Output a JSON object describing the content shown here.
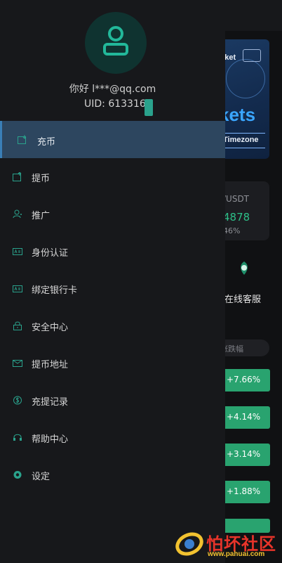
{
  "drawer": {
    "greeting": "你好 l***@qq.com",
    "uid": "UID: 613316"
  },
  "menu": [
    {
      "label": "充币",
      "icon": "deposit-icon",
      "active": true
    },
    {
      "label": "提币",
      "icon": "withdraw-icon"
    },
    {
      "label": "推广",
      "icon": "promote-icon"
    },
    {
      "label": "身份认证",
      "icon": "id-card-icon"
    },
    {
      "label": "绑定银行卡",
      "icon": "bank-card-icon"
    },
    {
      "label": "安全中心",
      "icon": "lock-icon"
    },
    {
      "label": "提币地址",
      "icon": "address-icon"
    },
    {
      "label": "充提记录",
      "icon": "coin-record-icon"
    },
    {
      "label": "帮助中心",
      "icon": "headset-icon"
    },
    {
      "label": "设定",
      "icon": "settings-icon"
    }
  ],
  "background": {
    "banner_title": "rket",
    "banner_big": "kets",
    "banner_sub": "Timezone",
    "ticker_pair": "/USDT",
    "ticker_price": "4878",
    "ticker_change": "46%",
    "service_label": "在线客服",
    "filter_label": "涨跌幅",
    "changes": [
      "+7.66%",
      "+4.14%",
      "+3.14%",
      "+1.88%"
    ]
  },
  "watermark": {
    "text": "怕坏社区",
    "url": "www.pahuai.com"
  },
  "colors": {
    "accent": "#2aa28c",
    "active_bg": "#2d465f",
    "rise": "#29a36f"
  }
}
